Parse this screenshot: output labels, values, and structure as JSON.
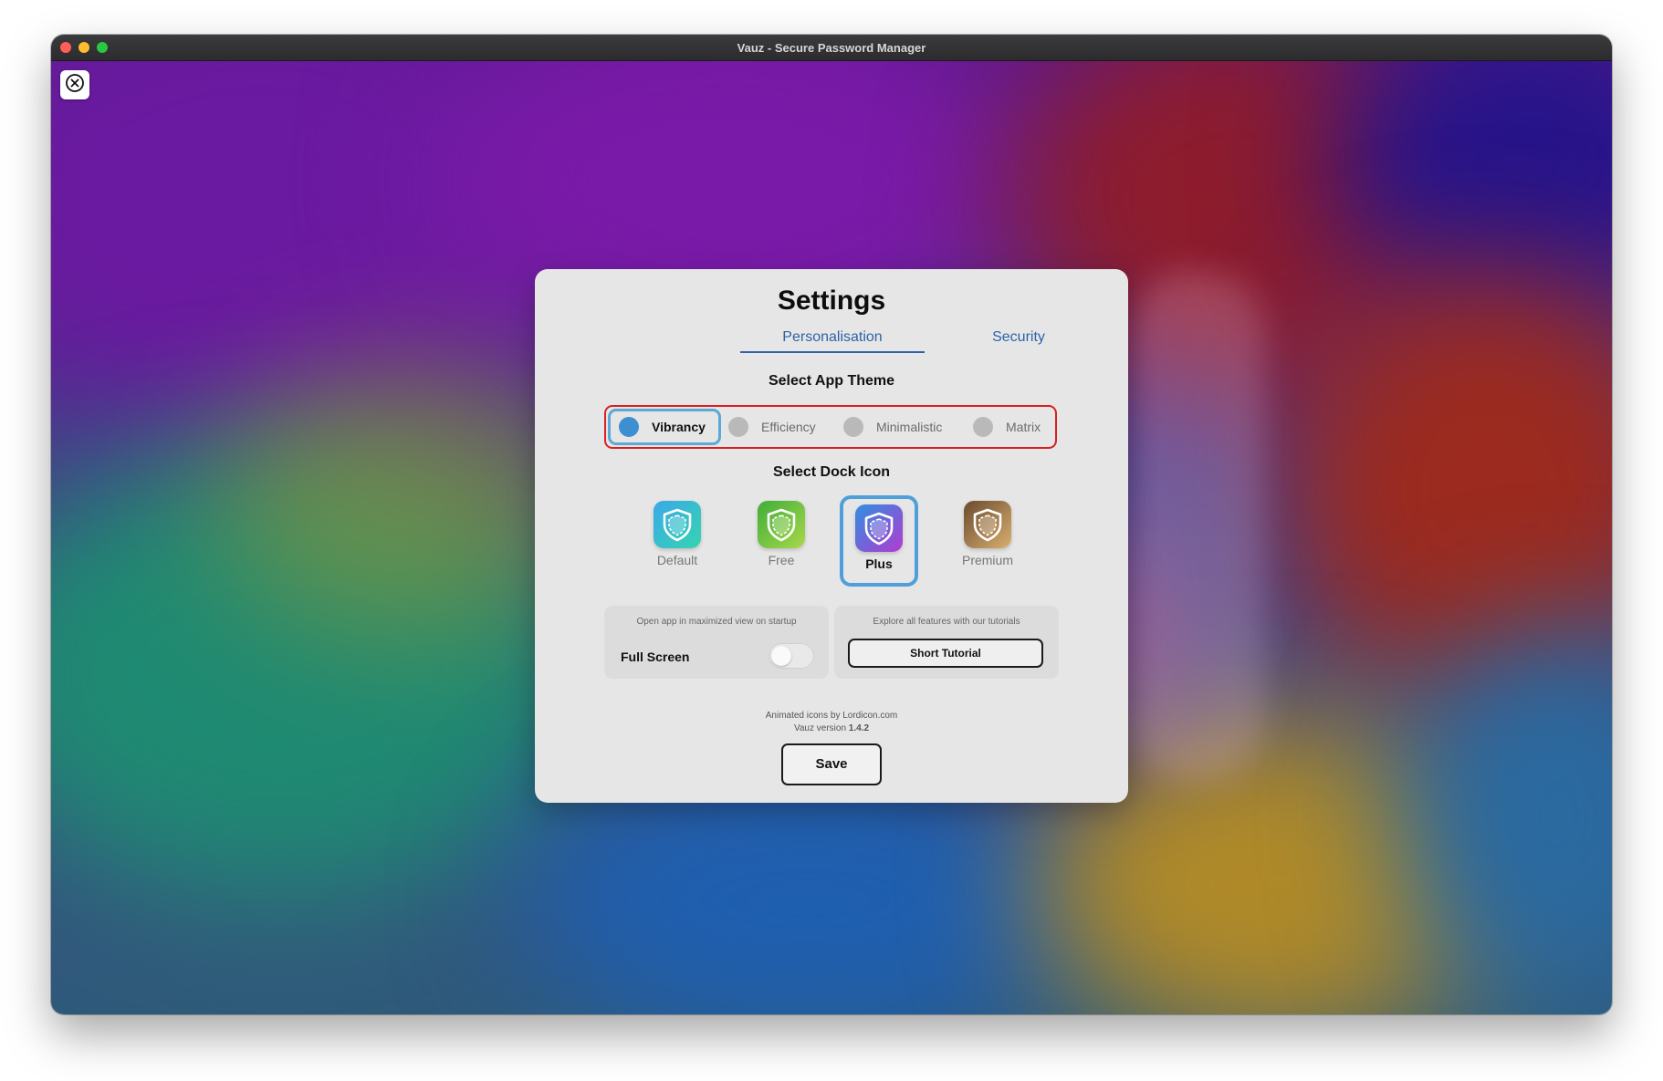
{
  "window": {
    "title": "Vauz - Secure Password Manager"
  },
  "settings": {
    "title": "Settings",
    "tabs": [
      {
        "label": "Personalisation",
        "active": true
      },
      {
        "label": "Security",
        "active": false
      }
    ],
    "theme": {
      "heading": "Select App Theme",
      "options": [
        "Vibrancy",
        "Efficiency",
        "Minimalistic",
        "Matrix"
      ],
      "selected": "Vibrancy"
    },
    "dock": {
      "heading": "Select Dock Icon",
      "options": [
        {
          "label": "Default",
          "color_a": "#3aa9e8",
          "color_b": "#36d4b0"
        },
        {
          "label": "Free",
          "color_a": "#3fae3a",
          "color_b": "#a8d84a"
        },
        {
          "label": "Plus",
          "color_a": "#2f8fe0",
          "color_b": "#b23bd1"
        },
        {
          "label": "Premium",
          "color_a": "#6b4a2e",
          "color_b": "#d9b070"
        }
      ],
      "selected": "Plus"
    },
    "fullscreen": {
      "hint": "Open app in maximized view on startup",
      "label": "Full Screen",
      "enabled": false
    },
    "tutorial": {
      "hint": "Explore all features with our tutorials",
      "button": "Short Tutorial"
    },
    "credits": {
      "line1": "Animated icons by Lordicon.com",
      "version_prefix": "Vauz version",
      "version": "1.4.2"
    },
    "save_label": "Save"
  },
  "colors": {
    "accent": "#2e62a8",
    "selection": "#4f9fd8",
    "error_outline": "#d92020"
  },
  "icons": {
    "close": "close-circle-icon",
    "shield": "shield-icon"
  }
}
